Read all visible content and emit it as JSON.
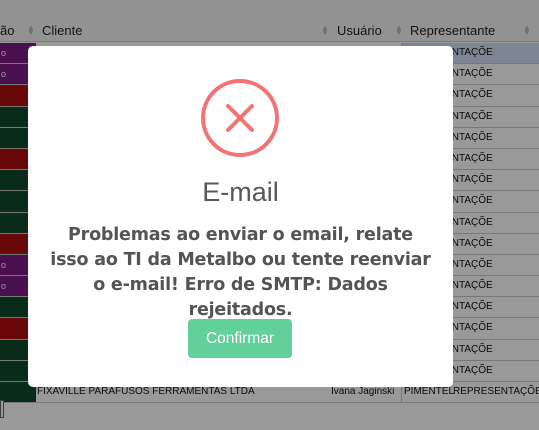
{
  "table": {
    "headers": {
      "status": "ão",
      "cliente": "Cliente",
      "usuario": "Usuário",
      "representante": "Representante"
    },
    "visible_rows": [
      {
        "status": "o",
        "status_color": "#7b1a84",
        "representante": "REPRESENTAÇÕE"
      },
      {
        "status": "o",
        "status_color": "#7b1a84",
        "representante": "REPRESENTAÇÕE"
      },
      {
        "status": "",
        "status_color": "#b00e0e",
        "representante": "REPRESENTAÇÕE"
      },
      {
        "status": "",
        "status_color": "#0e4a2a",
        "representante": "REPRESENTAÇÕE"
      },
      {
        "status": "",
        "status_color": "#0e4a2a",
        "representante": "REPRESENTAÇÕE"
      },
      {
        "status": "",
        "status_color": "#b00e0e",
        "representante": "REPRESENTAÇÕE"
      },
      {
        "status": "",
        "status_color": "#0e4a2a",
        "representante": "REPRESENTAÇÕE"
      },
      {
        "status": "",
        "status_color": "#0e4a2a",
        "representante": "REPRESENTAÇÕE"
      },
      {
        "status": "",
        "status_color": "#0e4a2a",
        "representante": "REPRESENTAÇÕE"
      },
      {
        "status": "",
        "status_color": "#b00e0e",
        "representante": "REPRESENTAÇÕE"
      },
      {
        "status": "o",
        "status_color": "#7b1a84",
        "representante": "REPRESENTAÇÕE"
      },
      {
        "status": "o",
        "status_color": "#7b1a84",
        "representante": "REPRESENTAÇÕE"
      },
      {
        "status": "",
        "status_color": "#0e4a2a",
        "representante": "REPRESENTAÇÕE"
      },
      {
        "status": "",
        "status_color": "#b00e0e",
        "representante": "REPRESENTAÇÕE"
      },
      {
        "status": "",
        "status_color": "#0e4a2a",
        "representante": "REPRESENTAÇÕE"
      },
      {
        "status": "",
        "status_color": "#0e4a2a",
        "representante": "REPRESENTAÇÕE"
      },
      {
        "status": "",
        "status_color": "#0e4a2a",
        "cliente": "FIXAVILLE PARAFUSOS FERRAMENTAS LTDA",
        "usuario": "Ivana Jaginski",
        "representante": "PIMENTEL",
        "representante_alt": "REPRESENTAÇÕE"
      }
    ]
  },
  "modal": {
    "icon": "error-x-icon",
    "title": "E-mail",
    "message": "Problemas ao enviar o email, relate isso ao TI da Metalbo ou tente reenviar o e-mail! Erro de SMTP: Dados rejeitados.",
    "confirm_label": "Confirmar",
    "icon_color": "#f27474",
    "button_color": "#61d09b"
  }
}
